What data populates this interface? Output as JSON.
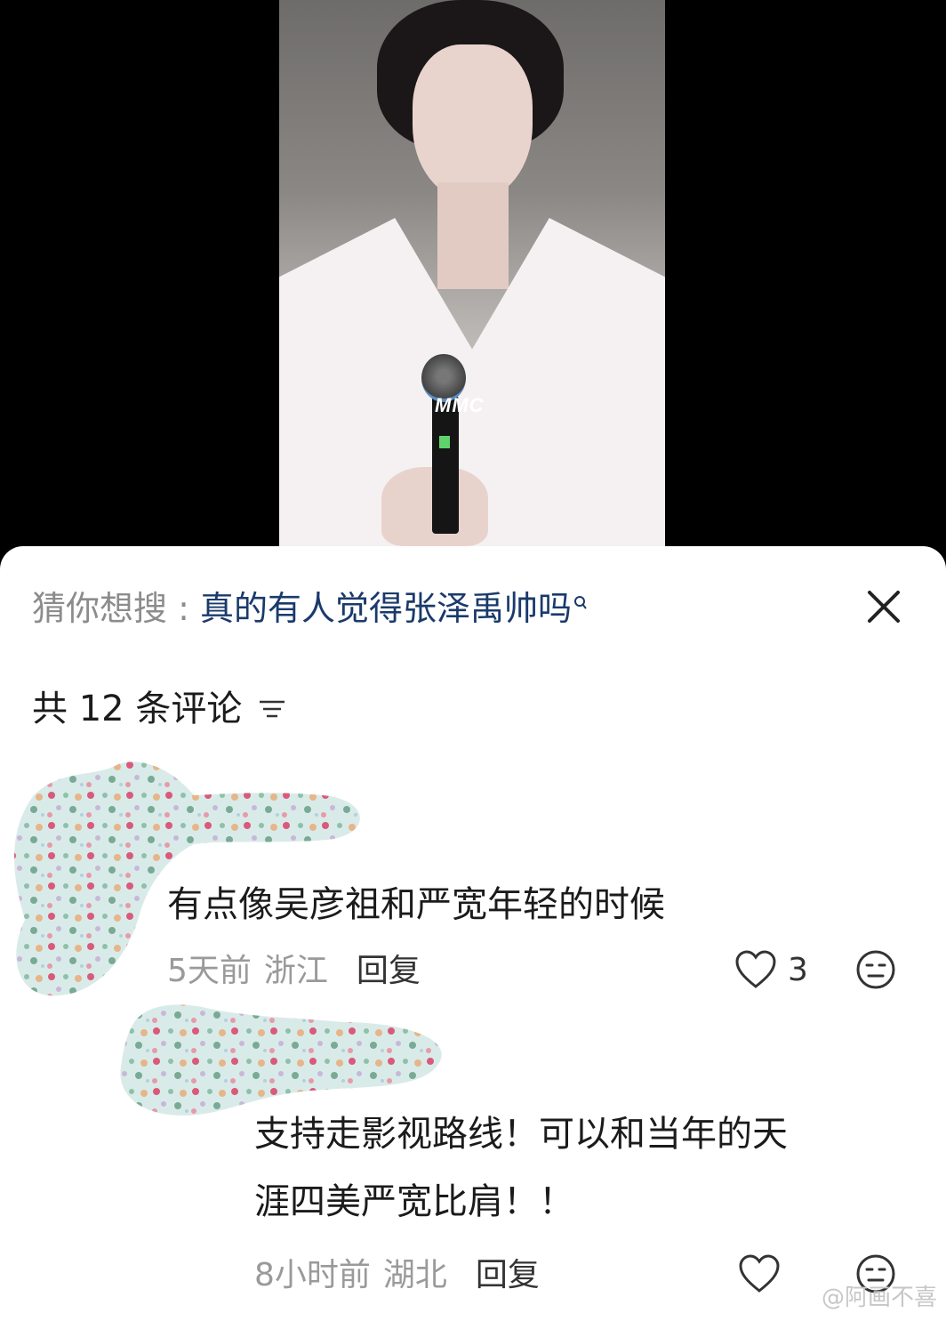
{
  "photo": {
    "watermark": "MMC"
  },
  "suggestion": {
    "prefix": "猜你想搜 : ",
    "query": "真的有人觉得张泽禹帅吗",
    "search_mark": "Q"
  },
  "comments_header": {
    "label": "共 12 条评论"
  },
  "comments": [
    {
      "text_lines": [
        "有点像吴彦祖和严宽年轻的时候"
      ],
      "time": "5天前",
      "location": "浙江",
      "reply_label": "回复",
      "likes": "3"
    },
    {
      "text_lines": [
        "支持走影视路线！可以和当年的天",
        "涯四美严宽比肩！！"
      ],
      "time": "8小时前",
      "location": "湖北",
      "reply_label": "回复",
      "likes": ""
    }
  ],
  "corner_watermark": "@阿画不喜",
  "colors": {
    "query_link": "#1a3a6b",
    "secondary_text": "#9a9a9a",
    "primary_text": "#1b1b1b"
  }
}
